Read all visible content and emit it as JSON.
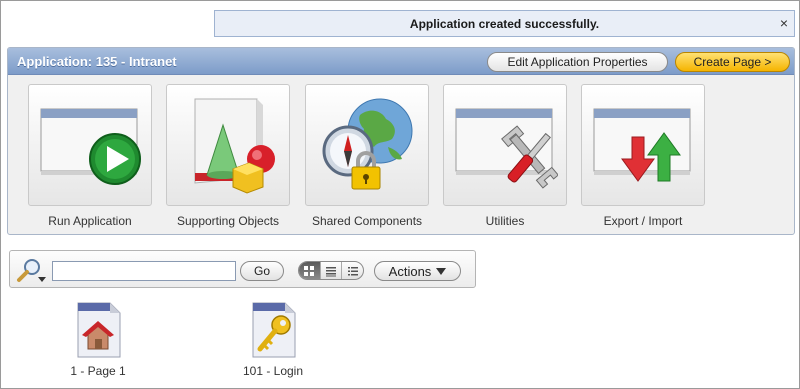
{
  "notification": {
    "message": "Application created successfully.",
    "close_glyph": "×"
  },
  "application": {
    "title": "Application: 135 - Intranet",
    "edit_button": "Edit Application Properties",
    "create_button": "Create Page >"
  },
  "tiles": [
    {
      "label": "Run Application",
      "icon": "run-application-icon"
    },
    {
      "label": "Supporting Objects",
      "icon": "supporting-objects-icon"
    },
    {
      "label": "Shared Components",
      "icon": "shared-components-icon"
    },
    {
      "label": "Utilities",
      "icon": "utilities-icon"
    },
    {
      "label": "Export / Import",
      "icon": "export-import-icon"
    }
  ],
  "search": {
    "value": "",
    "go_label": "Go",
    "view_modes": [
      "icons",
      "report",
      "details"
    ],
    "active_view": "icons",
    "actions_label": "Actions"
  },
  "pages": [
    {
      "label": "1 - Page 1",
      "icon": "page-home-icon"
    },
    {
      "label": "101 - Login",
      "icon": "page-key-icon"
    }
  ],
  "colors": {
    "header_blue": "#7d9cc9",
    "create_button_yellow": "#f5b400",
    "notification_bg": "#e9eef7"
  }
}
